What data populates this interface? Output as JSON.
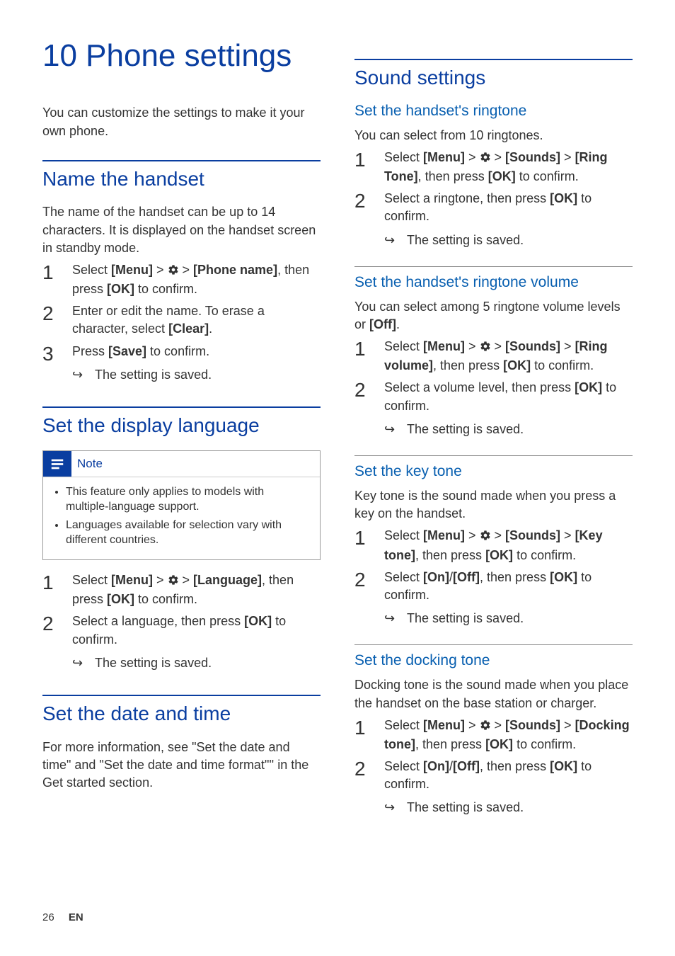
{
  "chapter": {
    "title": "10 Phone settings"
  },
  "intro": "You can customize the settings to make it your own phone.",
  "name_handset": {
    "heading": "Name the handset",
    "desc": "The name of the handset can be up to 14 characters. It is displayed on the handset screen in standby mode.",
    "step1_a": "Select ",
    "step1_b": "[Menu]",
    "step1_c": " > ",
    "step1_d": " > ",
    "step1_e": "[Phone name]",
    "step1_f": ", then press ",
    "step1_g": "[OK]",
    "step1_h": " to confirm.",
    "step2_a": "Enter or edit the name. To erase a character, select ",
    "step2_b": "[Clear]",
    "step2_c": ".",
    "step3_a": "Press ",
    "step3_b": "[Save]",
    "step3_c": " to confirm.",
    "result": "The setting is saved."
  },
  "display_lang": {
    "heading": "Set the display language",
    "note_label": "Note",
    "note1": "This feature only applies to models with multiple-language support.",
    "note2": "Languages available for selection vary with different countries.",
    "step1_a": "Select ",
    "step1_b": "[Menu]",
    "step1_c": " > ",
    "step1_d": " > ",
    "step1_e": "[Language]",
    "step1_f": ", then press ",
    "step1_g": "[OK]",
    "step1_h": " to confirm.",
    "step2_a": "Select a language, then press ",
    "step2_b": "[OK]",
    "step2_c": " to confirm.",
    "result": "The setting is saved."
  },
  "date_time": {
    "heading": "Set the date and time",
    "desc": "For more information, see \"Set the date and time\" and \"Set the date and time format\"'' in the Get started section."
  },
  "sound": {
    "heading": "Sound settings",
    "ringtone": {
      "heading": "Set the handset's ringtone",
      "desc": "You can select from 10 ringtones.",
      "step1_a": "Select ",
      "step1_b": "[Menu]",
      "step1_c": " > ",
      "step1_d": " > ",
      "step1_e": "[Sounds]",
      "step1_f": " > ",
      "step1_g": "[Ring Tone]",
      "step1_h": ", then press ",
      "step1_i": "[OK]",
      "step1_j": " to confirm.",
      "step2_a": "Select a ringtone, then press ",
      "step2_b": "[OK]",
      "step2_c": " to confirm.",
      "result": "The setting is saved."
    },
    "ring_volume": {
      "heading": "Set the handset's ringtone volume",
      "desc_a": "You can select among 5 ringtone volume levels or ",
      "desc_b": "[Off]",
      "desc_c": ".",
      "step1_a": "Select ",
      "step1_b": "[Menu]",
      "step1_c": " > ",
      "step1_d": " > ",
      "step1_e": "[Sounds]",
      "step1_f": " > ",
      "step1_g": "[Ring volume]",
      "step1_h": ", then press ",
      "step1_i": "[OK]",
      "step1_j": " to confirm.",
      "step2_a": "Select a volume level, then press ",
      "step2_b": "[OK]",
      "step2_c": " to confirm.",
      "result": "The setting is saved."
    },
    "key_tone": {
      "heading": "Set the key tone",
      "desc": "Key tone is the sound made when you press a key on the handset.",
      "step1_a": "Select ",
      "step1_b": "[Menu]",
      "step1_c": " > ",
      "step1_d": " > ",
      "step1_e": "[Sounds]",
      "step1_f": " > ",
      "step1_g": "[Key tone]",
      "step1_h": ", then press ",
      "step1_i": "[OK]",
      "step1_j": " to confirm.",
      "step2_a": "Select ",
      "step2_b": "[On]",
      "step2_c": "/",
      "step2_d": "[Off]",
      "step2_e": ", then press ",
      "step2_f": "[OK]",
      "step2_g": " to confirm.",
      "result": "The setting is saved."
    },
    "docking_tone": {
      "heading": "Set the docking tone",
      "desc": "Docking tone is the sound made when you place the handset on the base station or charger.",
      "step1_a": "Select ",
      "step1_b": "[Menu]",
      "step1_c": " > ",
      "step1_d": " > ",
      "step1_e": "[Sounds]",
      "step1_f": " > ",
      "step1_g": "[Docking tone]",
      "step1_h": ", then press ",
      "step1_i": "[OK]",
      "step1_j": " to confirm.",
      "step2_a": "Select ",
      "step2_b": "[On]",
      "step2_c": "/",
      "step2_d": "[Off]",
      "step2_e": ", then press ",
      "step2_f": "[OK]",
      "step2_g": " to confirm.",
      "result": "The setting is saved."
    }
  },
  "footer": {
    "page": "26",
    "lang": "EN"
  }
}
